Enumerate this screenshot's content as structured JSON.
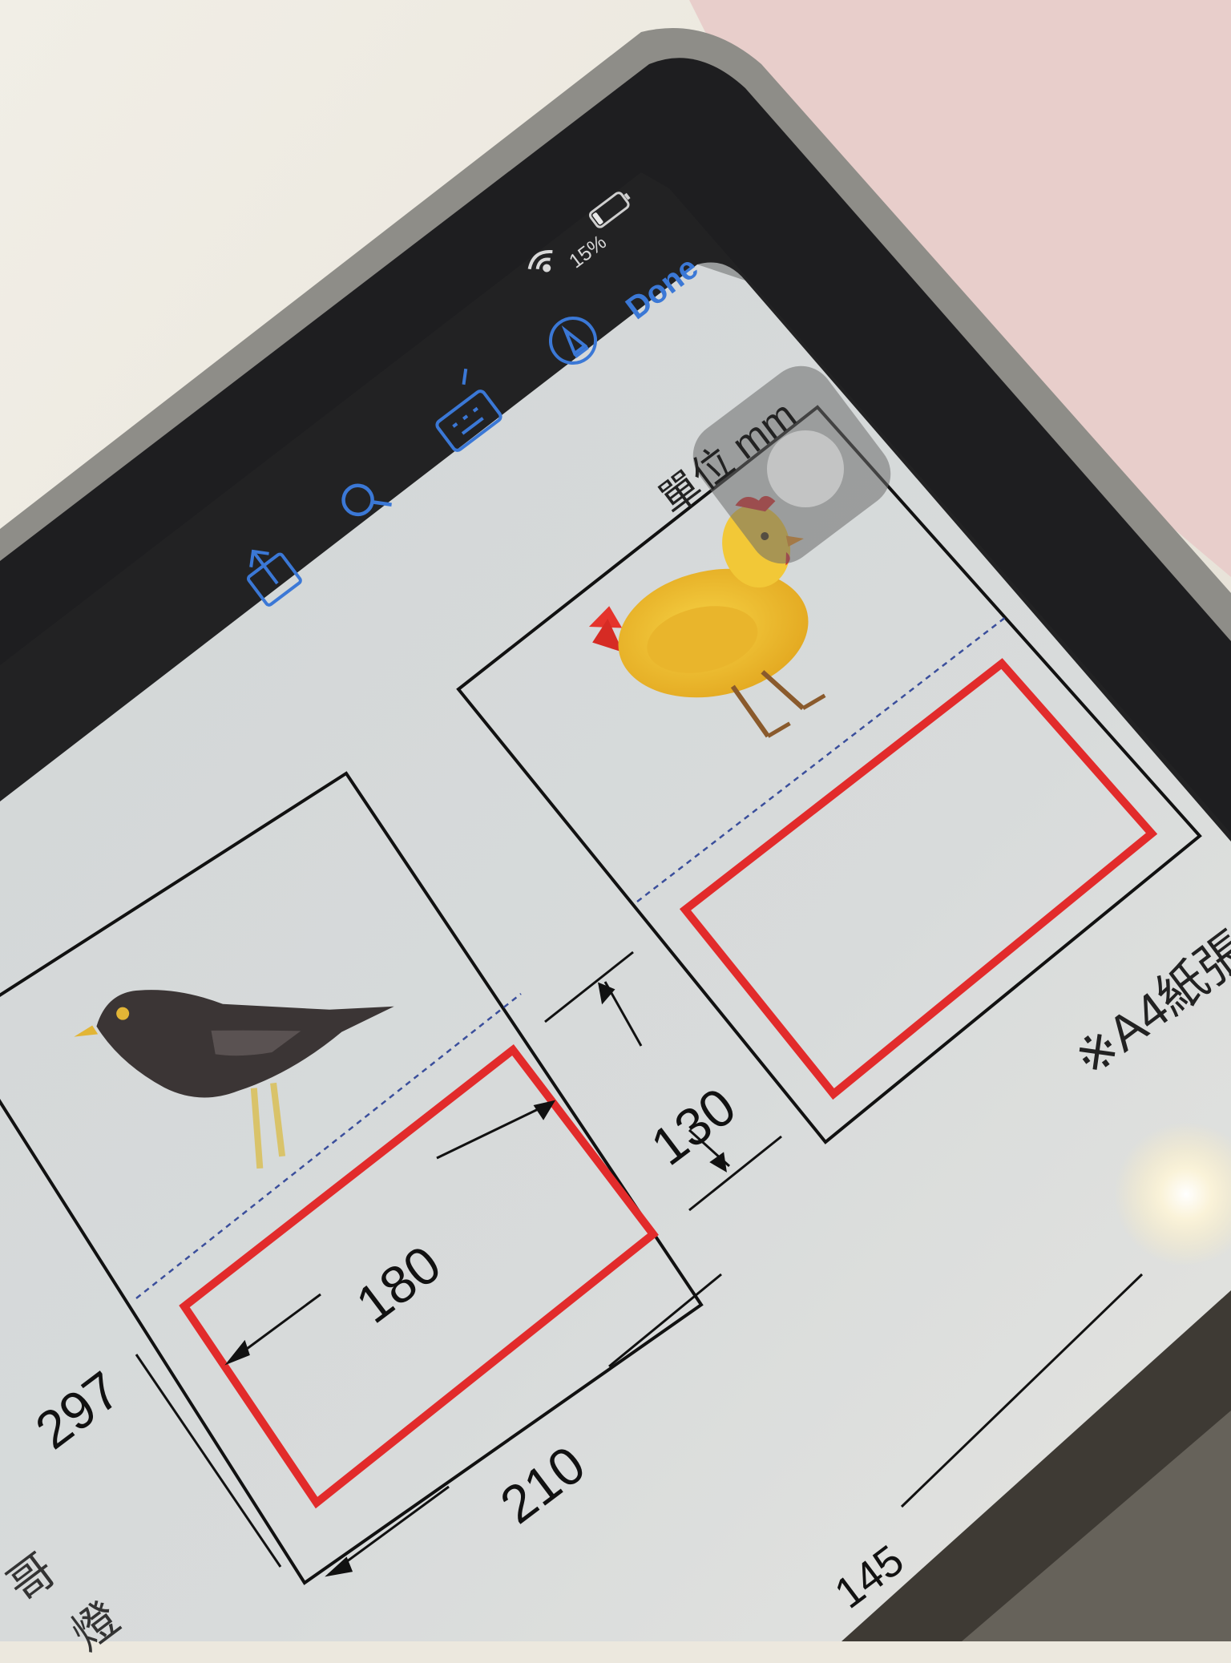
{
  "status_bar": {
    "battery_percent": "15%",
    "battery_level": 0.15
  },
  "toolbar": {
    "done_label": "Done",
    "icons": [
      "share-icon",
      "search-icon",
      "keyboard-icon",
      "markup-pen-icon"
    ]
  },
  "document": {
    "unit_label": "單位 mm",
    "note_label": "※A4紙張",
    "dim_180": "180",
    "dim_130": "130",
    "dim_297": "297",
    "dim_210": "210",
    "dim_145": "145",
    "partial_text_1": "哥",
    "partial_text_2": "燈"
  },
  "colors": {
    "accent_blue": "#3b78d6",
    "frame_red": "#e22b2b",
    "page_gray": "#d6d9d9",
    "device_dark": "#1f1f21",
    "case_gray": "#8f8e88",
    "fabric_pink": "#e9cfcc"
  }
}
